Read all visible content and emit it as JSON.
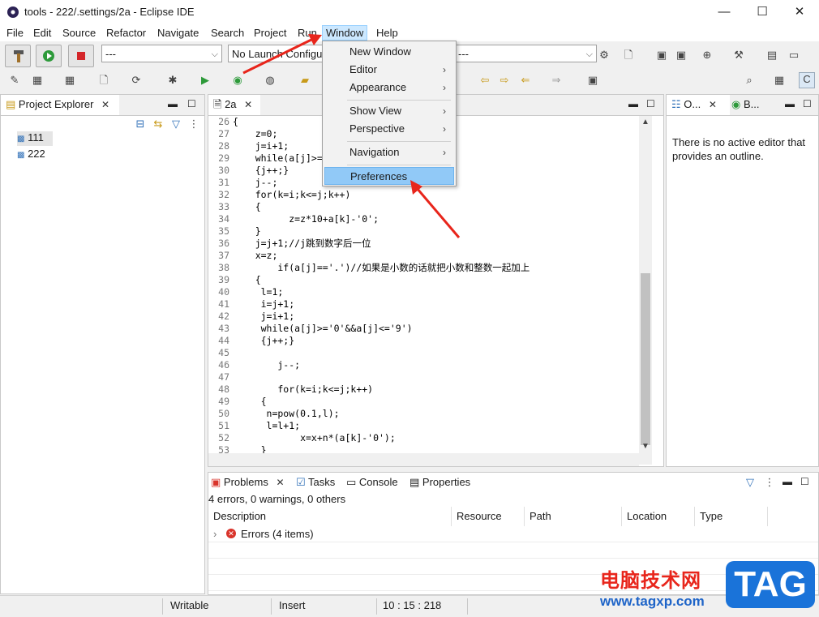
{
  "window": {
    "title": "tools - 222/.settings/2a - Eclipse IDE",
    "minimize": "—",
    "maximize": "☐",
    "close": "✕"
  },
  "menu": [
    "File",
    "Edit",
    "Source",
    "Refactor",
    "Navigate",
    "Search",
    "Project",
    "Run",
    "Window",
    "Help"
  ],
  "toolbar": {
    "run_config": "---",
    "launch_config": "No Launch Configu",
    "target": "---"
  },
  "project_explorer": {
    "tab_label": "Project Explorer",
    "items": [
      "111",
      "222"
    ]
  },
  "editor": {
    "tab_label": "2a",
    "line_numbers": [
      "26",
      "27",
      "28",
      "29",
      "30",
      "31",
      "32",
      "33",
      "34",
      "35",
      "36",
      "37",
      "38",
      "39",
      "40",
      "41",
      "42",
      "43",
      "44",
      "45",
      "46",
      "47",
      "48",
      "49",
      "50",
      "51",
      "52",
      "53"
    ],
    "lines": [
      "{",
      "    z=0;",
      "    j=i+1;",
      "    while(a[j]>=",
      "    {j++;}",
      "    j--;",
      "    for(k=i;k<=j;k++)",
      "    {",
      "          z=z*10+a[k]-'0';",
      "    }",
      "    j=j+1;//j跳到数字后一位",
      "    x=z;",
      "        if(a[j]=='.')//如果是小数的话就把小数和整数一起加上",
      "    {",
      "     l=1;",
      "     i=j+1;",
      "     j=i+1;",
      "     while(a[j]>='0'&&a[j]<='9')",
      "     {j++;}",
      "",
      "        j--;",
      "",
      "        for(k=i;k<=j;k++)",
      "     {",
      "      n=pow(0.1,l);",
      "      l=l+1;",
      "            x=x+n*(a[k]-'0');",
      "     }"
    ]
  },
  "outline": {
    "tab1": "O...",
    "tab2": "B...",
    "message": "There is no active editor that provides an outline."
  },
  "problems": {
    "tabs": [
      "Problems",
      "Tasks",
      "Console",
      "Properties"
    ],
    "summary": "4 errors, 0 warnings, 0 others",
    "columns": [
      "Description",
      "Resource",
      "Path",
      "Location",
      "Type"
    ],
    "rows": [
      "Errors (4 items)"
    ]
  },
  "status": {
    "writable": "Writable",
    "insert": "Insert",
    "position": "10 : 15 : 218"
  },
  "window_menu": {
    "items": [
      "New Window",
      "Editor",
      "Appearance",
      "Show View",
      "Perspective",
      "Navigation",
      "Preferences"
    ],
    "highlighted": "Preferences"
  },
  "watermark": {
    "cn": "电脑技术网",
    "url": "www.tagxp.com",
    "tag": "TAG"
  },
  "colors": {
    "accent": "#1a73d9",
    "menu_highlight": "#91c9f7",
    "arrow": "#e8251b",
    "error": "#d9342b"
  }
}
